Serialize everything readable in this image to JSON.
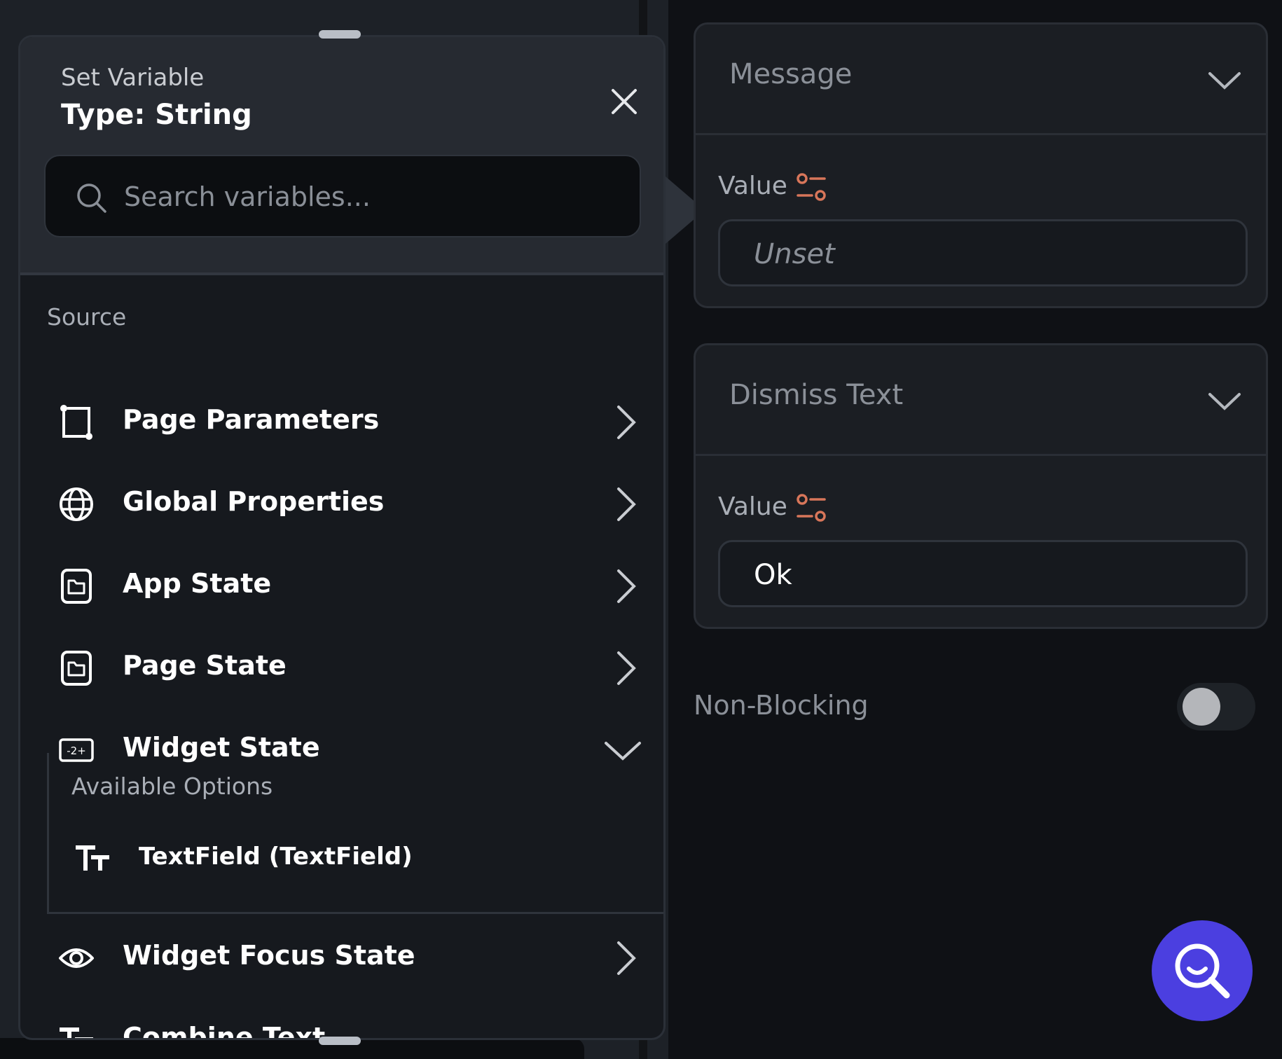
{
  "popup": {
    "subtitle": "Set Variable",
    "title": "Type: String",
    "search": {
      "placeholder": "Search variables..."
    },
    "section_label": "Source",
    "items": [
      {
        "label": "Page Parameters",
        "icon": "page-parameters-icon"
      },
      {
        "label": "Global Properties",
        "icon": "globe-icon"
      },
      {
        "label": "App State",
        "icon": "app-state-icon"
      },
      {
        "label": "Page State",
        "icon": "page-state-icon"
      },
      {
        "label": "Widget State",
        "icon": "widget-state-icon",
        "expanded": true
      },
      {
        "label": "Widget Focus State",
        "icon": "eye-icon"
      },
      {
        "label": "Combine Text",
        "icon": "text-icon"
      }
    ],
    "widget_state": {
      "options_label": "Available Options",
      "options": [
        {
          "label": "TextField (TextField)",
          "icon": "text-icon"
        }
      ]
    }
  },
  "panel": {
    "message": {
      "title": "Message",
      "value_label": "Value",
      "value": "Unset"
    },
    "dismiss": {
      "title": "Dismiss Text",
      "value_label": "Value",
      "value": "Ok"
    },
    "non_blocking": {
      "label": "Non-Blocking",
      "on": false
    }
  },
  "colors": {
    "accent": "#4b3fe0",
    "value_icon": "#d8765a",
    "popup_bg": "#16191e",
    "header_bg": "#262a31"
  }
}
